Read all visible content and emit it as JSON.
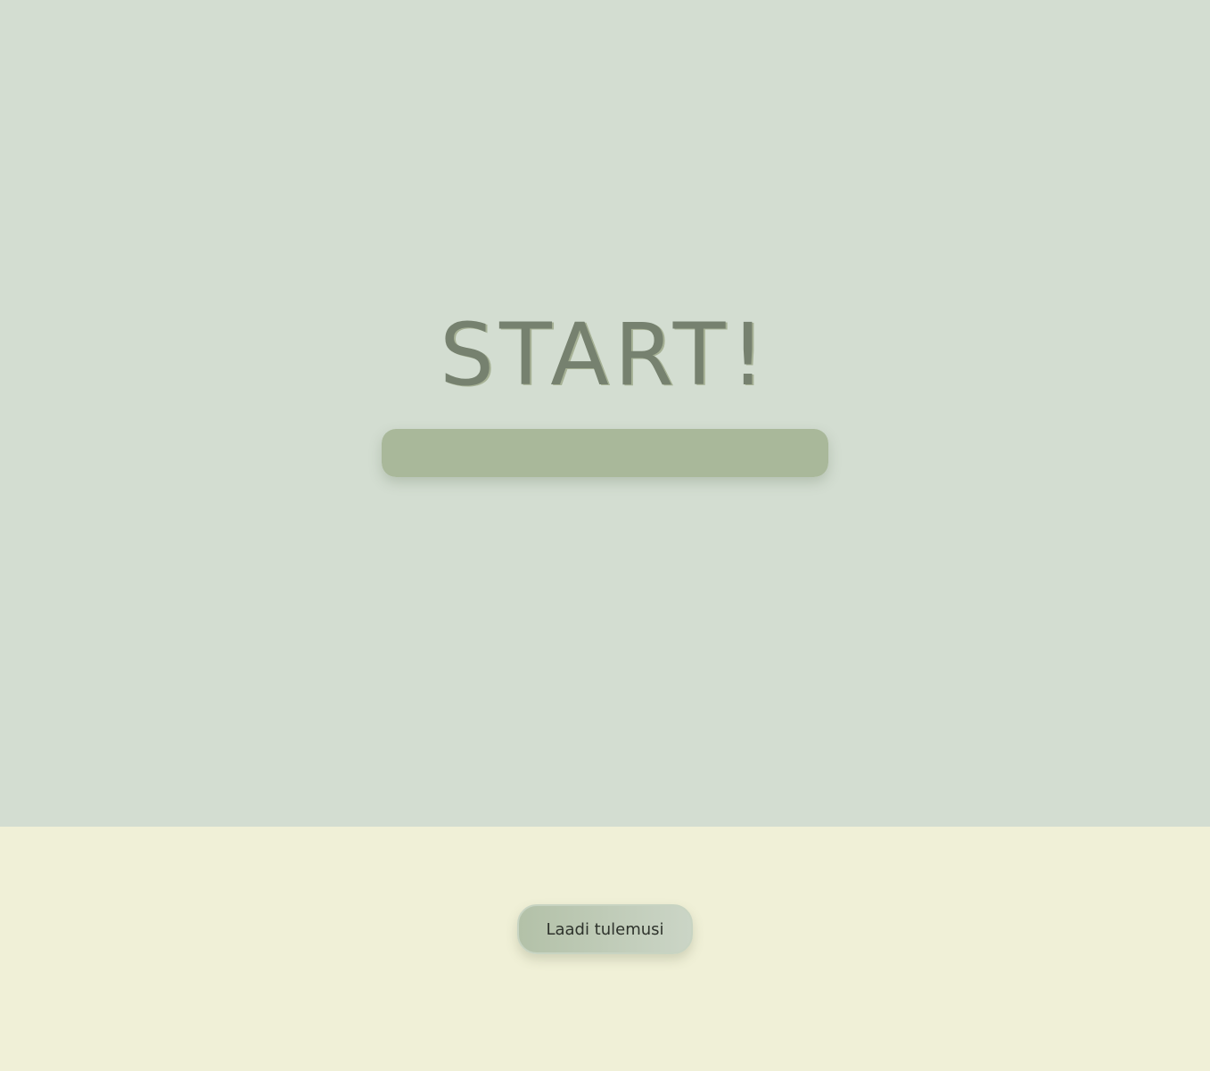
{
  "title": "START!",
  "progress": {
    "fraction": 1.0,
    "fill_color": "#a9b89a"
  },
  "actions": {
    "load_results_label": "Laadi tulemusi"
  },
  "colors": {
    "top_background": "#d3ddd1",
    "bottom_background": "#f0f0d7",
    "title_color": "#76816f"
  }
}
